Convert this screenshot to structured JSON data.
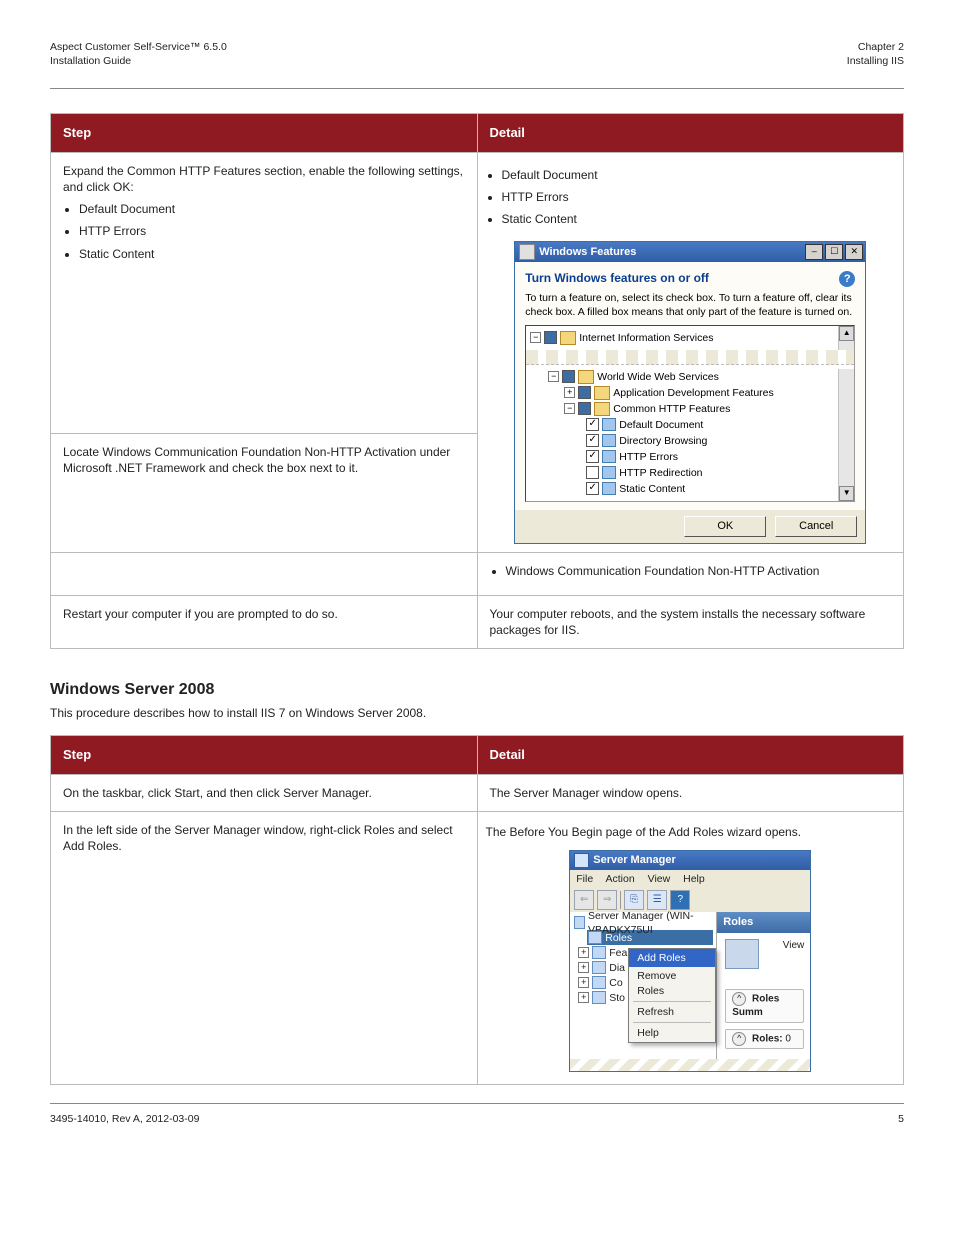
{
  "header": {
    "left_line1": "Aspect Customer Self-Service™ 6.5.0",
    "left_line2": "Installation Guide",
    "right_line1": "Chapter 2",
    "right_line2": "Installing IIS"
  },
  "table1": {
    "head_left": "Step",
    "head_right": "Detail",
    "rows": [
      {
        "step": "Expand the Common HTTP Features section, enable the following settings, and click OK:",
        "bullets": [
          "Default Document",
          "HTTP Errors",
          "Static Content"
        ]
      },
      {
        "step": "Locate Windows Communication Foundation Non-HTTP Activation under Microsoft .NET Framework and check the box next to it.",
        "bullets": [
          "Windows Communication Foundation Non-HTTP Activation"
        ]
      },
      {
        "step": "Restart your computer if you are prompted to do so.",
        "detail": "Your computer reboots, and the system installs the necessary software packages for IIS."
      }
    ]
  },
  "wf": {
    "title": "Windows Features",
    "heading": "Turn Windows features on or off",
    "desc": "To turn a feature on, select its check box. To turn a feature off, clear its check box. A filled box means that only part of the feature is turned on.",
    "iis": "Internet Information Services",
    "nodes": {
      "www": "World Wide Web Services",
      "adf": "Application Development Features",
      "chf": "Common HTTP Features",
      "dd": "Default Document",
      "db": "Directory Browsing",
      "he": "HTTP Errors",
      "hr": "HTTP Redirection",
      "sc": "Static Content"
    },
    "ok": "OK",
    "cancel": "Cancel"
  },
  "section": {
    "heading": "Windows Server 2008",
    "text": "This procedure describes how to install IIS 7 on Windows Server 2008."
  },
  "table2": {
    "head_left": "Step",
    "head_right": "Detail",
    "rows": [
      {
        "step": "On the taskbar, click Start, and then click Server Manager.",
        "detail": "The Server Manager window opens."
      },
      {
        "step": "In the left side of the Server Manager window, right-click Roles and select Add Roles.",
        "detail": "The Before You Begin page of the Add Roles wizard opens."
      }
    ]
  },
  "sm": {
    "title": "Server Manager",
    "menu": [
      "File",
      "Action",
      "View",
      "Help"
    ],
    "root": "Server Manager (WIN-VBADKX75UI",
    "nodes": {
      "roles": "Roles",
      "fea": "Fea",
      "dia": "Dia",
      "con": "Co",
      "sto": "Sto"
    },
    "popup": {
      "add": "Add Roles",
      "remove": "Remove Roles",
      "refresh": "Refresh",
      "help": "Help"
    },
    "right_hdr": "Roles",
    "view": "View",
    "roles_sum": "Roles Summ",
    "roles_count_label": "Roles:",
    "roles_count": "0"
  },
  "footer": {
    "left": "3495-14010, Rev A, 2012-03-09",
    "right": "5"
  }
}
